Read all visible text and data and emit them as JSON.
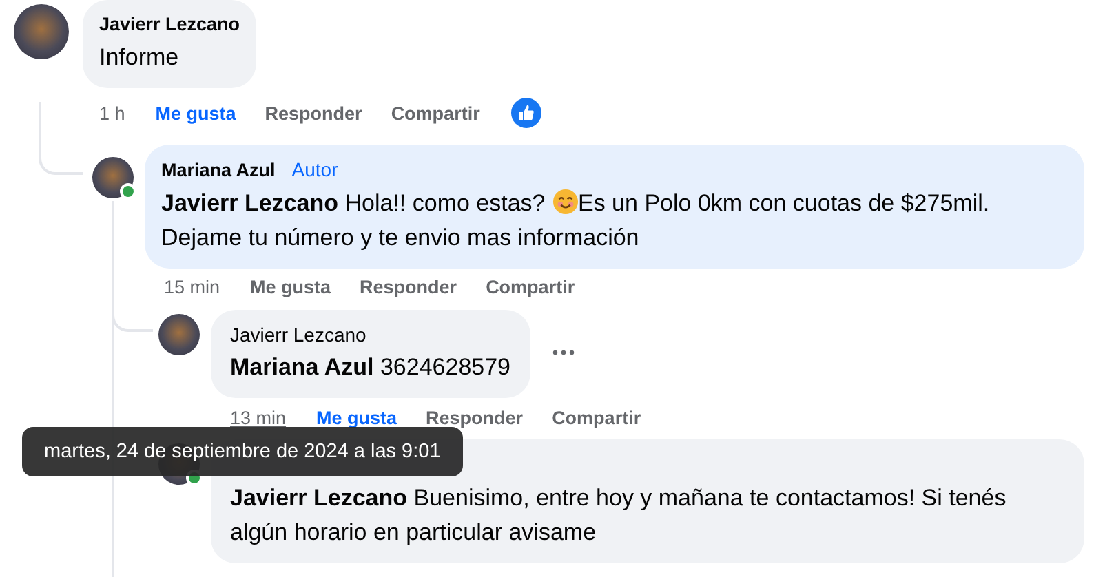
{
  "comments": [
    {
      "author": "Javierr Lezcano",
      "highlighted": false,
      "segments": [
        {
          "kind": "text",
          "text": "Informe"
        }
      ],
      "time": "1 h",
      "time_hovered": false,
      "liked": true,
      "like_label": "Me gusta",
      "reply_label": "Responder",
      "share_label": "Compartir",
      "reaction": true,
      "children": [
        {
          "author": "Mariana Azul",
          "badge": "Autor",
          "online": true,
          "highlighted": true,
          "mention": "Javierr Lezcano",
          "segments": [
            {
              "kind": "text",
              "text": "Hola!! como estas? "
            },
            {
              "kind": "emoji"
            },
            {
              "kind": "text",
              "text": "Es un Polo 0km con cuotas de $275mil. Dejame tu número y te envio mas información"
            }
          ],
          "time": "15 min",
          "time_hovered": false,
          "liked": false,
          "like_label": "Me gusta",
          "reply_label": "Responder",
          "share_label": "Compartir",
          "children": [
            {
              "author": "Javierr Lezcano",
              "highlighted": false,
              "mention": "Mariana Azul",
              "segments": [
                {
                  "kind": "text",
                  "text": "3624628579"
                }
              ],
              "time": "13 min",
              "time_hovered": true,
              "liked": true,
              "like_label": "Me gusta",
              "reply_label": "Responder",
              "share_label": "Compartir",
              "more": true
            },
            {
              "online": true,
              "highlighted": false,
              "mention": "Javierr Lezcano",
              "segments": [
                {
                  "kind": "text",
                  "text": "Buenisimo, entre hoy y mañana te contactamos! Si tenés algún horario en particular avisame"
                }
              ]
            }
          ]
        }
      ]
    }
  ],
  "tooltip": "martes, 24 de septiembre de 2024 a las 9:01"
}
